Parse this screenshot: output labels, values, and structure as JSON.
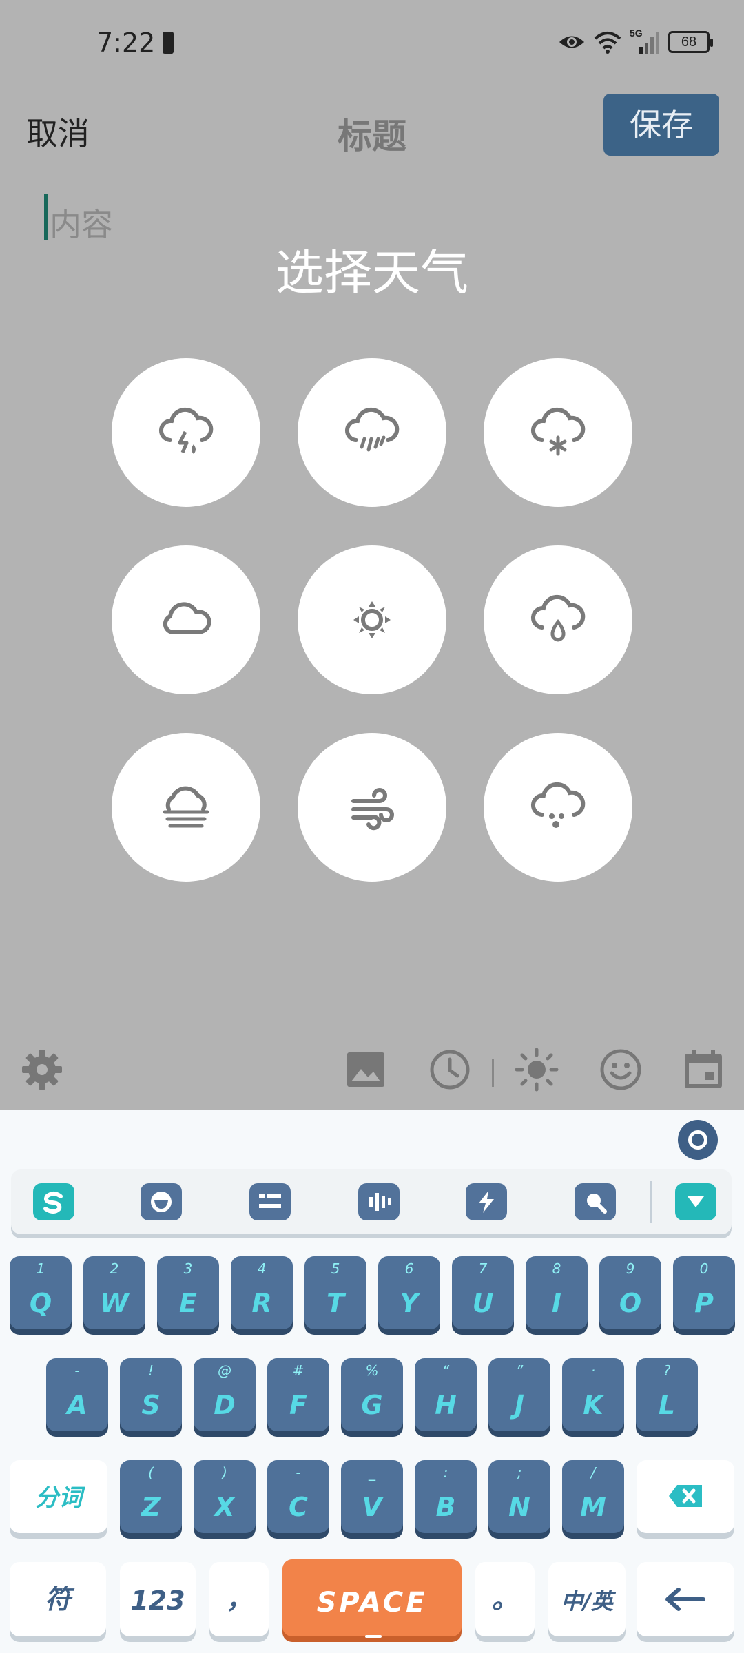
{
  "status": {
    "time": "7:22",
    "network": "5G",
    "battery": "68"
  },
  "header": {
    "cancel_label": "取消",
    "title": "标题",
    "save_label": "保存"
  },
  "editor": {
    "content_placeholder": "内容"
  },
  "dialog": {
    "title": "选择天气",
    "options": [
      {
        "icon": "thunderstorm-icon"
      },
      {
        "icon": "rain-icon"
      },
      {
        "icon": "snow-icon"
      },
      {
        "icon": "cloudy-icon"
      },
      {
        "icon": "sunny-icon"
      },
      {
        "icon": "drizzle-icon"
      },
      {
        "icon": "fog-icon"
      },
      {
        "icon": "wind-icon"
      },
      {
        "icon": "hail-icon"
      }
    ]
  },
  "toolbar": {
    "icons": [
      "settings-icon",
      "image-icon",
      "clock-icon",
      "weather-icon",
      "emoji-icon",
      "calendar-icon"
    ]
  },
  "keyboard": {
    "row1": [
      {
        "main": "Q",
        "sub": "1"
      },
      {
        "main": "W",
        "sub": "2"
      },
      {
        "main": "E",
        "sub": "3"
      },
      {
        "main": "R",
        "sub": "4"
      },
      {
        "main": "T",
        "sub": "5"
      },
      {
        "main": "Y",
        "sub": "6"
      },
      {
        "main": "U",
        "sub": "7"
      },
      {
        "main": "I",
        "sub": "8"
      },
      {
        "main": "O",
        "sub": "9"
      },
      {
        "main": "P",
        "sub": "0"
      }
    ],
    "row2": [
      {
        "main": "A",
        "sub": "-"
      },
      {
        "main": "S",
        "sub": "!"
      },
      {
        "main": "D",
        "sub": "@"
      },
      {
        "main": "F",
        "sub": "#"
      },
      {
        "main": "G",
        "sub": "%"
      },
      {
        "main": "H",
        "sub": "“"
      },
      {
        "main": "J",
        "sub": "”"
      },
      {
        "main": "K",
        "sub": "·"
      },
      {
        "main": "L",
        "sub": "?"
      }
    ],
    "row3": [
      {
        "main": "Z",
        "sub": "("
      },
      {
        "main": "X",
        "sub": ")"
      },
      {
        "main": "C",
        "sub": "-"
      },
      {
        "main": "V",
        "sub": "_"
      },
      {
        "main": "B",
        "sub": ":"
      },
      {
        "main": "N",
        "sub": ";"
      },
      {
        "main": "M",
        "sub": "/"
      }
    ],
    "fenci_label": "分词",
    "fu_label": "符",
    "num_label": "123",
    "comma_label": "，",
    "space_label": "SPACE",
    "period_label": "。",
    "lang_label": "中/英"
  }
}
